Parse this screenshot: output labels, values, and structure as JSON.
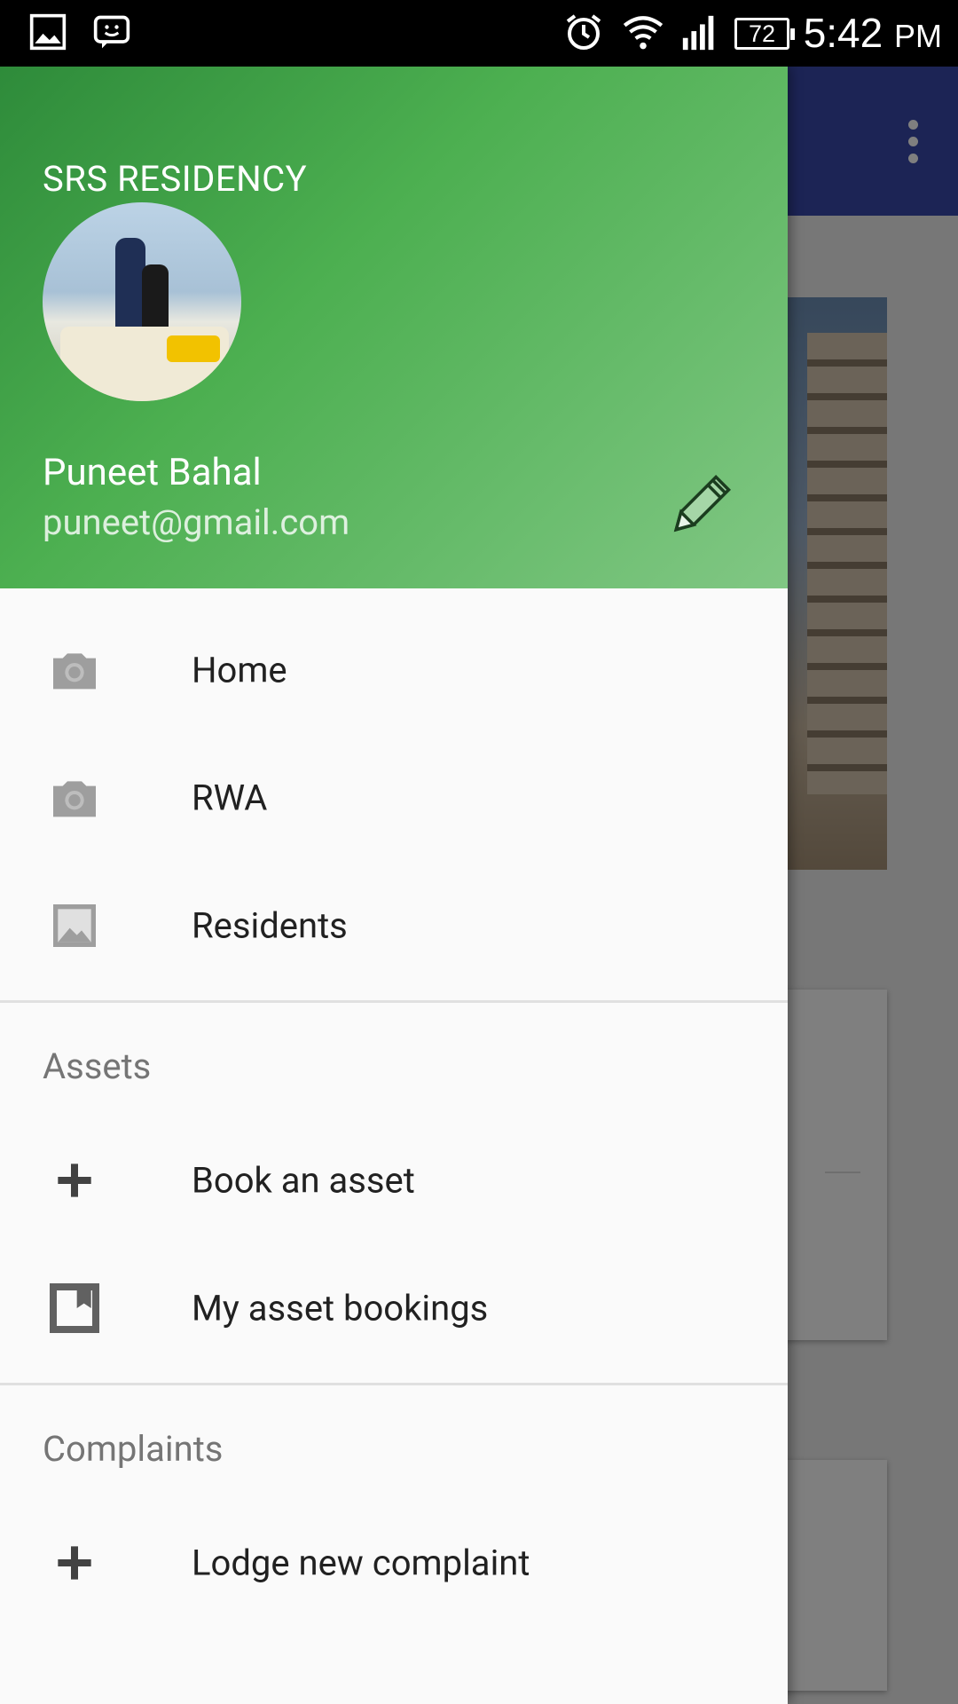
{
  "status_bar": {
    "battery": "72",
    "time": "5:42",
    "ampm": "PM"
  },
  "drawer": {
    "header": {
      "society_name": "SRS RESIDENCY",
      "user_name": "Puneet Bahal",
      "user_email": "puneet@gmail.com"
    },
    "items": [
      {
        "label": "Home",
        "icon": "camera-icon"
      },
      {
        "label": "RWA",
        "icon": "camera-icon"
      },
      {
        "label": "Residents",
        "icon": "image-icon"
      }
    ],
    "sections": [
      {
        "title": "Assets",
        "items": [
          {
            "label": "Book an asset",
            "icon": "plus-icon"
          },
          {
            "label": "My asset bookings",
            "icon": "bookmark-icon"
          }
        ]
      },
      {
        "title": "Complaints",
        "items": [
          {
            "label": "Lodge new complaint",
            "icon": "plus-icon"
          }
        ]
      }
    ]
  },
  "colors": {
    "header_green": "#4caf50",
    "toolbar_indigo": "#3949ab"
  }
}
